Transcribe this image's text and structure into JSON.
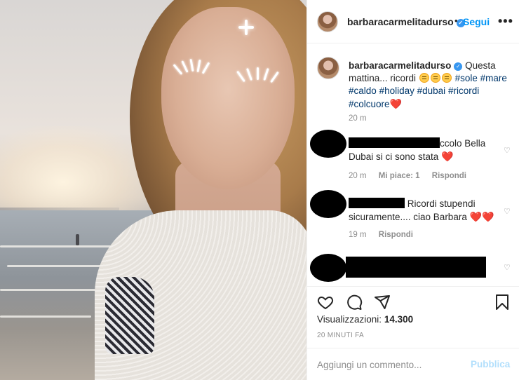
{
  "header": {
    "username": "barbaracarmelitadurso",
    "verified_icon": "verified-badge-icon",
    "separator": "•",
    "follow_label": "Segui",
    "more_label": "•••"
  },
  "caption": {
    "username": "barbaracarmelitadurso",
    "text_start": "Questa mattina... ricordi",
    "emojis": [
      "star-struck-emoji",
      "star-struck-emoji",
      "star-struck-emoji"
    ],
    "hashtags": [
      "#sole",
      "#mare",
      "#caldo",
      "#holiday",
      "#dubai",
      "#ricordi",
      "#colcuore"
    ],
    "heart": "❤️",
    "time": "20 m"
  },
  "comments": [
    {
      "visible_text": "ccolo Bella Dubai si ci sono stata",
      "heart": "❤️",
      "time": "20 m",
      "likes_label": "Mi piace: 1",
      "reply_label": "Rispondi"
    },
    {
      "visible_text_a": "Ricordi stupendi",
      "visible_text_b": "sicuramente.... ciao Barbara",
      "hearts": "❤️❤️",
      "time": "19 m",
      "reply_label": "Rispondi"
    },
    {
      "visible_text": ""
    }
  ],
  "stats": {
    "views_label": "Visualizzazioni:",
    "views_value": "14.300",
    "posted": "20 MINUTI FA"
  },
  "add_comment": {
    "placeholder": "Aggiungi un commento...",
    "publish_label": "Pubblica"
  },
  "colors": {
    "accent": "#0095f6",
    "publish_disabled": "#b2dffc",
    "hashtag": "#00376b",
    "heart": "#e0245e"
  }
}
